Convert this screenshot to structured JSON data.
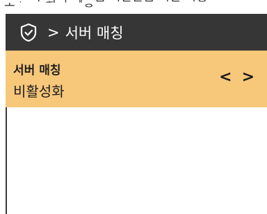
{
  "header": {
    "separator": ">",
    "title": "서버 매칭"
  },
  "setting": {
    "label": "서버 매칭",
    "value": "비활성화",
    "prev_symbol": "<",
    "next_symbol": ">"
  },
  "colors": {
    "header_bg": "#363636",
    "row_bg": "#f7c77a",
    "text_dark": "#1e1e1e",
    "header_text": "#ffffff"
  },
  "icons": {
    "header_icon": "shield-check-icon"
  }
}
